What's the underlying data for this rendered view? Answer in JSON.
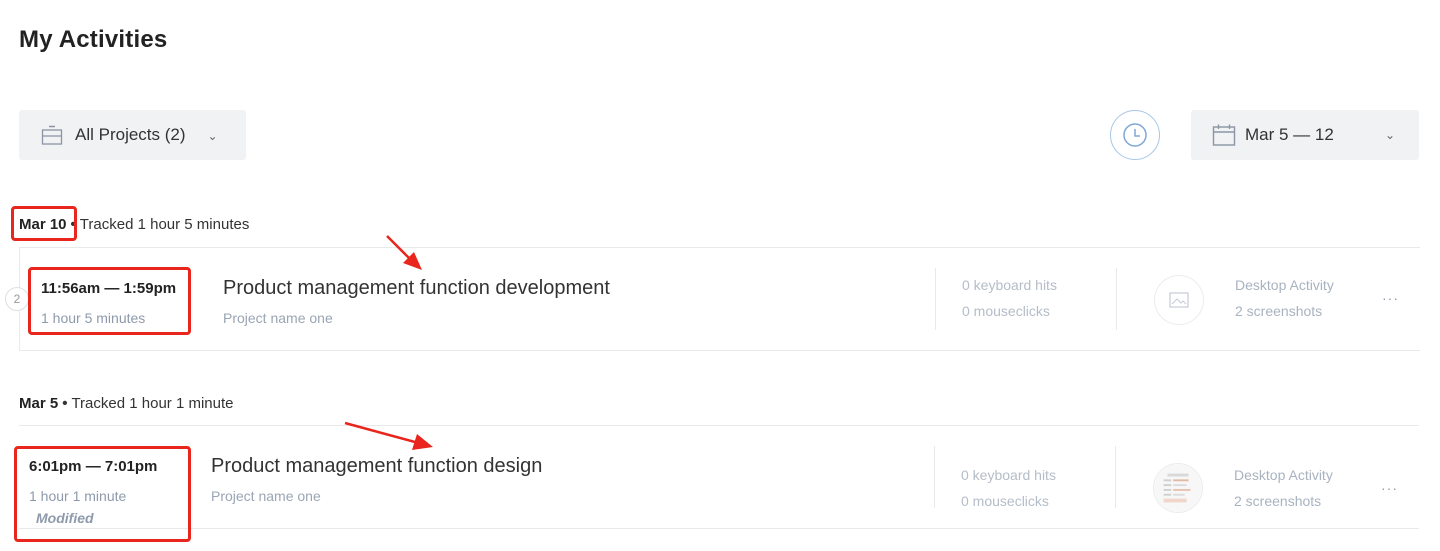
{
  "page": {
    "title": "My Activities"
  },
  "filters": {
    "projects_label": "All Projects (2)",
    "date_range_label": "Mar 5 — 12",
    "chevron": "⌄"
  },
  "days": [
    {
      "date": "Mar 10",
      "tracked": "Tracked 1 hour 5 minutes",
      "activity": {
        "group_count": "2",
        "time_range": "11:56am — 1:59pm",
        "duration": "1 hour 5 minutes",
        "title": "Product management function development",
        "project": "Project name one",
        "keyboard_hits": "0 keyboard hits",
        "mouseclicks": "0 mouseclicks",
        "desktop_label": "Desktop Activity",
        "screenshots": "2 screenshots",
        "more": "···"
      }
    },
    {
      "date": "Mar 5",
      "tracked": "Tracked 1 hour 1 minute",
      "activity": {
        "time_range": "6:01pm — 7:01pm",
        "duration": "1 hour 1 minute",
        "modified": "Modified",
        "title": "Product management function design",
        "project": "Project name one",
        "keyboard_hits": "0 keyboard hits",
        "mouseclicks": "0 mouseclicks",
        "desktop_label": "Desktop Activity",
        "screenshots": "2 screenshots",
        "more": "···"
      }
    }
  ],
  "icons": {
    "briefcase": "briefcase-icon",
    "clock": "clock-icon",
    "calendar": "calendar-icon",
    "screenshot_placeholder": "image-placeholder-icon",
    "screenshot_thumbnail": "screenshot-thumbnail"
  },
  "colors": {
    "annotation_red": "#e8261d",
    "filter_bg": "#f1f2f4",
    "clock_blue": "#a9c6e6",
    "muted_text": "#8e9aab"
  }
}
